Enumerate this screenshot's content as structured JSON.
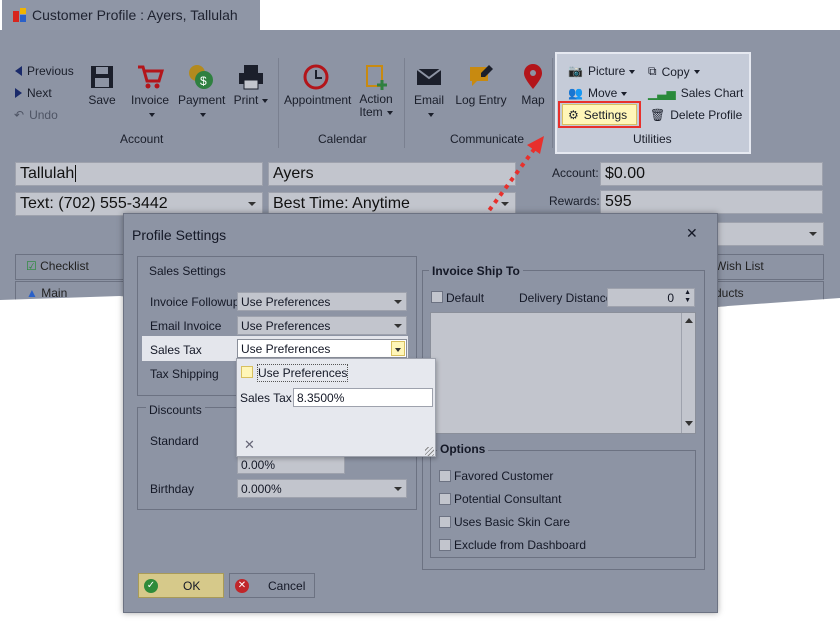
{
  "window": {
    "tab_title": "Customer Profile : Ayers, Tallulah"
  },
  "ribbon": {
    "nav": {
      "previous": "Previous",
      "next": "Next",
      "undo": "Undo"
    },
    "buttons": {
      "save": "Save",
      "invoice": "Invoice",
      "payment": "Payment",
      "print": "Print",
      "appointment": "Appointment",
      "action_item_line1": "Action",
      "action_item_line2": "Item",
      "email": "Email",
      "log_entry": "Log Entry",
      "map": "Map"
    },
    "utilities": {
      "picture": "Picture",
      "move": "Move",
      "settings": "Settings",
      "copy": "Copy",
      "sales_chart": "Sales Chart",
      "delete_profile": "Delete Profile"
    },
    "groups": {
      "account": "Account",
      "calendar": "Calendar",
      "communicate": "Communicate",
      "utilities": "Utilities"
    }
  },
  "profile": {
    "first_name": "Tallulah",
    "last_name": "Ayers",
    "phone": "Text: (702) 555-3442",
    "best_time": "Best Time: Anytime",
    "account_label": "Account:",
    "account_value": "$0.00",
    "rewards_label": "Rewards:",
    "rewards_value": "595",
    "checklist": "Checklist",
    "main": "Main",
    "wish_list": "Wish List",
    "products": "ducts"
  },
  "dialog": {
    "title": "Profile Settings",
    "sales_settings": {
      "title": "Sales Settings",
      "invoice_followup_label": "Invoice Followup",
      "invoice_followup_value": "Use Preferences",
      "email_invoice_label": "Email Invoice",
      "email_invoice_value": "Use Preferences",
      "sales_tax_label": "Sales Tax",
      "sales_tax_value": "Use Preferences",
      "tax_shipping_label": "Tax Shipping"
    },
    "sales_tax_dropdown": {
      "option_use_preferences": "Use Preferences",
      "sales_tax_label": "Sales Tax",
      "sales_tax_value": "8.3500%"
    },
    "discounts": {
      "title": "Discounts",
      "standard_label": "Standard",
      "standard_value": "0.00%",
      "birthday_label": "Birthday",
      "birthday_value": "0.000%"
    },
    "invoice_ship_to": {
      "title": "Invoice Ship To",
      "default_label": "Default",
      "delivery_distance_label": "Delivery Distance",
      "delivery_distance_value": "0"
    },
    "options": {
      "title": "Options",
      "items": [
        "Favored Customer",
        "Potential Consultant",
        "Uses Basic Skin Care",
        "Exclude from Dashboard"
      ]
    },
    "ok_label": "OK",
    "cancel_label": "Cancel"
  },
  "colors": {
    "highlight": "#e8302c",
    "settings_bg": "#fff6b8",
    "dim": "#8d94a4",
    "ok_bg": "#d6c98a",
    "ok_check": "#2e8b3a",
    "cancel_x": "#c0262a"
  }
}
